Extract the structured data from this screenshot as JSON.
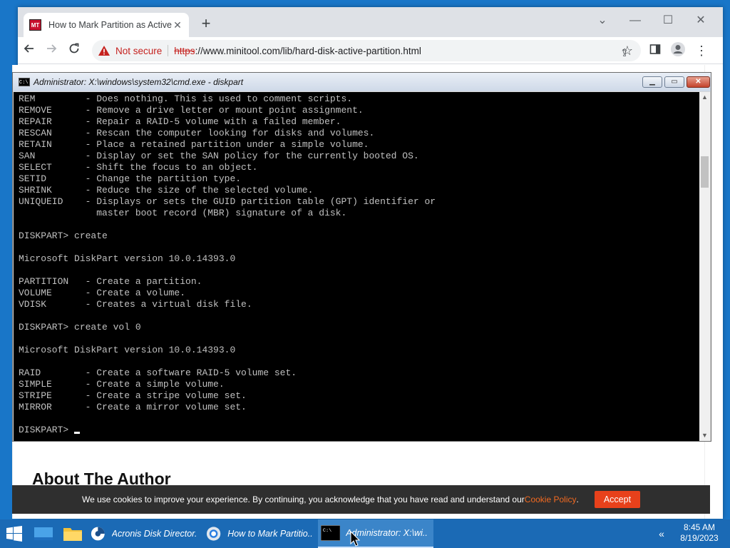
{
  "browser": {
    "tab_title": "How to Mark Partition as Active o",
    "favicon_text": "MT",
    "security_label": "Not secure",
    "url_scheme": "https",
    "url_rest": "://www.minitool.com/lib/hard-disk-active-partition.html"
  },
  "cmd": {
    "title": "Administrator: X:\\windows\\system32\\cmd.exe - diskpart",
    "icon_text": "C:\\",
    "output": "REM         - Does nothing. This is used to comment scripts.\nREMOVE      - Remove a drive letter or mount point assignment.\nREPAIR      - Repair a RAID-5 volume with a failed member.\nRESCAN      - Rescan the computer looking for disks and volumes.\nRETAIN      - Place a retained partition under a simple volume.\nSAN         - Display or set the SAN policy for the currently booted OS.\nSELECT      - Shift the focus to an object.\nSETID       - Change the partition type.\nSHRINK      - Reduce the size of the selected volume.\nUNIQUEID    - Displays or sets the GUID partition table (GPT) identifier or\n              master boot record (MBR) signature of a disk.\n\nDISKPART> create\n\nMicrosoft DiskPart version 10.0.14393.0\n\nPARTITION   - Create a partition.\nVOLUME      - Create a volume.\nVDISK       - Creates a virtual disk file.\n\nDISKPART> create vol 0\n\nMicrosoft DiskPart version 10.0.14393.0\n\nRAID        - Create a software RAID-5 volume set.\nSIMPLE      - Create a simple volume.\nSTRIPE      - Create a stripe volume set.\nMIRROR      - Create a mirror volume set.\n\n",
    "prompt": "DISKPART> "
  },
  "page": {
    "heading": "About The Author"
  },
  "cookie": {
    "text": "We use cookies to improve your experience. By continuing, you acknowledge that you have read and understand our ",
    "link": "Cookie Policy",
    "period": ".",
    "accept": "Accept"
  },
  "taskbar": {
    "items": [
      {
        "label": "Acronis Disk Director..."
      },
      {
        "label": "How to Mark Partitio..."
      },
      {
        "label": "Administrator: X:\\wi..."
      }
    ],
    "time": "8:45 AM",
    "date": "8/19/2023"
  },
  "colors": {
    "accent_orange": "#e8411b",
    "desktop_blue": "#1976c8",
    "taskbar_blue": "#1b6ab5"
  }
}
